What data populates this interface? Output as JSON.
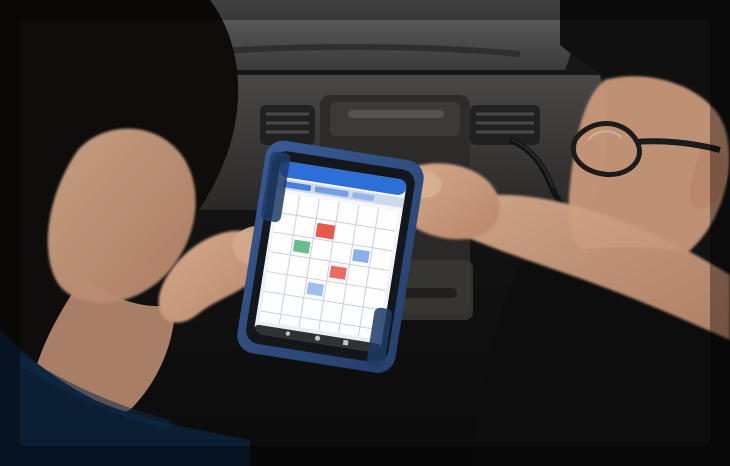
{
  "photo": {
    "subject": "",
    "palette": {
      "background": "#0f0f0f",
      "dashboard": "#3a3836",
      "skin": "#c99b7c",
      "hair": "#141110",
      "tablet_case": "#2f4f86",
      "screen_bg": "#f2f4f8",
      "ui_blue": "#2c6fd6",
      "ui_accent_red": "#e33b2e",
      "ui_accent_green": "#2aa15a"
    },
    "icons": {
      "car_vent": "vent-icon",
      "tablet": "tablet-icon"
    }
  }
}
